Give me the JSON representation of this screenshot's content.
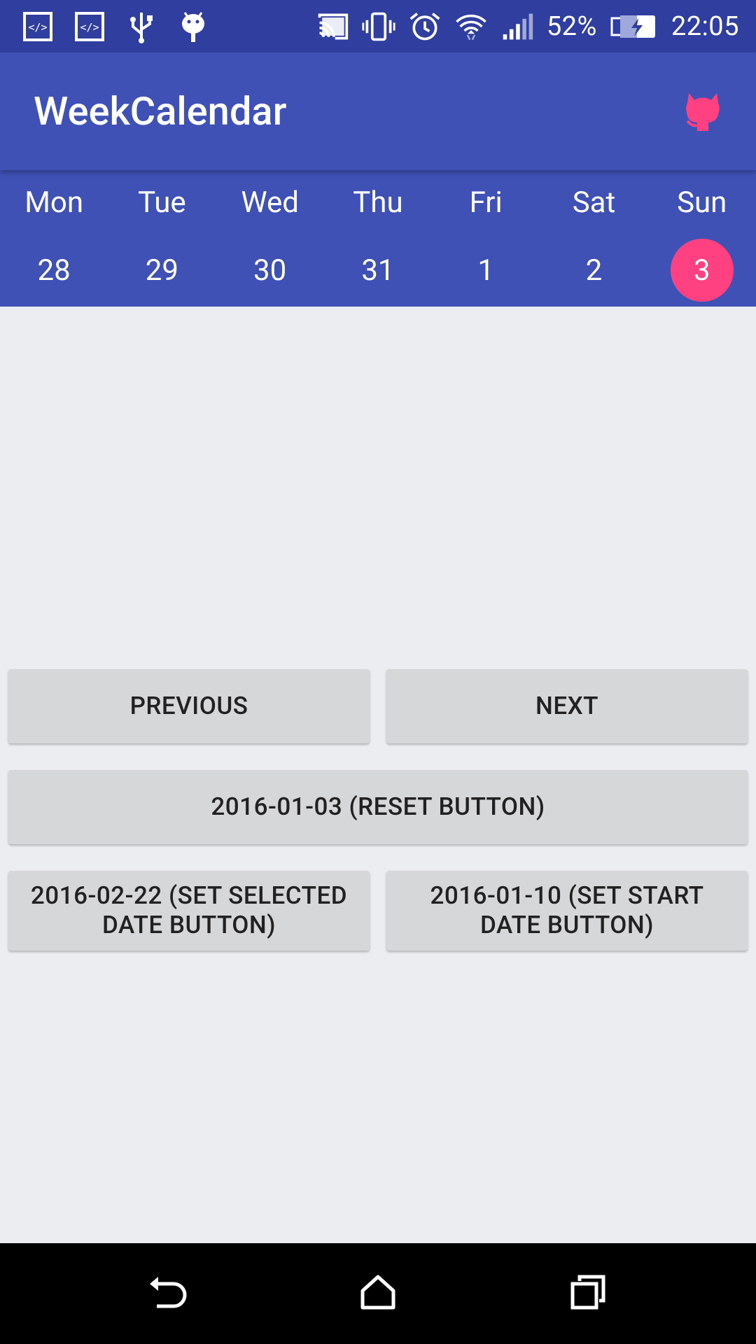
{
  "status_bar": {
    "battery_percent": "52%",
    "time": "22:05",
    "icons": [
      "code-icon",
      "code-icon",
      "usb-icon",
      "android-debug-icon",
      "cast-icon",
      "vibrate-icon",
      "alarm-icon",
      "wifi-icon",
      "signal-icon",
      "battery-charging-icon"
    ]
  },
  "app_bar": {
    "title": "WeekCalendar",
    "action_icon": "github-icon"
  },
  "week": {
    "day_names": [
      "Mon",
      "Tue",
      "Wed",
      "Thu",
      "Fri",
      "Sat",
      "Sun"
    ],
    "dates": [
      "28",
      "29",
      "30",
      "31",
      "1",
      "2",
      "3"
    ],
    "selected_index": 6
  },
  "buttons": {
    "previous": "PREVIOUS",
    "next": "NEXT",
    "reset": "2016-01-03 (RESET BUTTON)",
    "set_selected": "2016-02-22 (SET SELECTED DATE BUTTON)",
    "set_start": "2016-01-10 (SET START DATE BUTTON)"
  },
  "nav_bar": {
    "icons": [
      "back-icon",
      "home-icon",
      "recents-icon"
    ]
  },
  "colors": {
    "status_bar": "#303F9F",
    "primary": "#3F51B5",
    "accent": "#FF4081",
    "background": "#ECEDF1",
    "button": "#D6D7D9"
  }
}
